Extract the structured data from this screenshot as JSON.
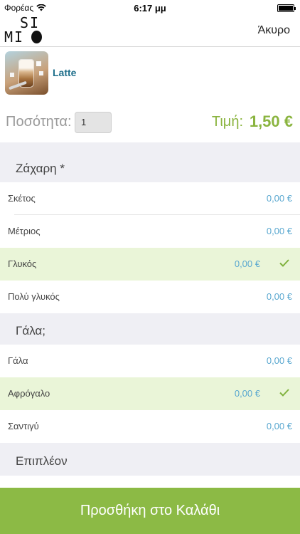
{
  "status_bar": {
    "carrier": "Φορέας",
    "time": "6:17 μμ"
  },
  "nav": {
    "logo_line1": "SI",
    "logo_line2": "MI",
    "cancel_label": "Άκυρο"
  },
  "product": {
    "name": "Latte"
  },
  "quantity": {
    "label": "Ποσότητα:",
    "value": "1"
  },
  "price": {
    "label": "Τιμή:",
    "value": "1,50 €"
  },
  "sections": [
    {
      "title": "Ζάχαρη *",
      "options": [
        {
          "label": "Σκέτος",
          "price": "0,00 €",
          "selected": false
        },
        {
          "label": "Μέτριος",
          "price": "0,00 €",
          "selected": false
        },
        {
          "label": "Γλυκός",
          "price": "0,00 €",
          "selected": true
        },
        {
          "label": "Πολύ γλυκός",
          "price": "0,00 €",
          "selected": false
        }
      ]
    },
    {
      "title": "Γάλα;",
      "options": [
        {
          "label": "Γάλα",
          "price": "0,00 €",
          "selected": false
        },
        {
          "label": "Αφρόγαλο",
          "price": "0,00 €",
          "selected": true
        },
        {
          "label": "Σαντιγύ",
          "price": "0,00 €",
          "selected": false
        }
      ]
    },
    {
      "title": "Επιπλέον",
      "options": []
    }
  ],
  "add_to_cart_label": "Προσθήκη στο Καλάθι",
  "colors": {
    "accent_green": "#8cba45",
    "price_green": "#8ab43f",
    "price_blue": "#5aa8d0",
    "selected_bg": "#eaf5d8",
    "section_bg": "#efeff4"
  }
}
